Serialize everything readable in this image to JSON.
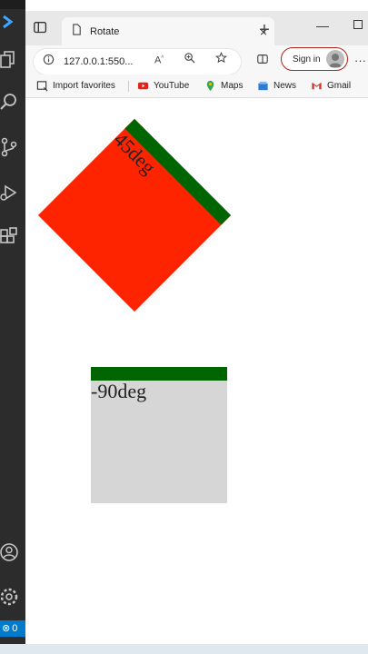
{
  "browser": {
    "tab_title": "Rotate",
    "tab_close": "×",
    "new_tab": "+",
    "address_url": "127.0.0.1:550...",
    "signin_label": "Sign in",
    "more": "···"
  },
  "favorites": [
    {
      "label": "Import favorites",
      "icon": "import-icon"
    },
    {
      "label": "YouTube",
      "icon": "youtube-icon"
    },
    {
      "label": "Maps",
      "icon": "maps-pin-icon"
    },
    {
      "label": "News",
      "icon": "news-icon"
    },
    {
      "label": "Gmail",
      "icon": "gmail-icon"
    }
  ],
  "page": {
    "box1_label": "45deg",
    "box2_label": "-90deg"
  },
  "status": {
    "errors": "0"
  },
  "colors": {
    "box1_bg": "#ff2400",
    "box_border": "#006400",
    "box2_bg": "#d6d6d6",
    "activity_bar": "#2c2c2c",
    "status_blue": "#007acc"
  }
}
